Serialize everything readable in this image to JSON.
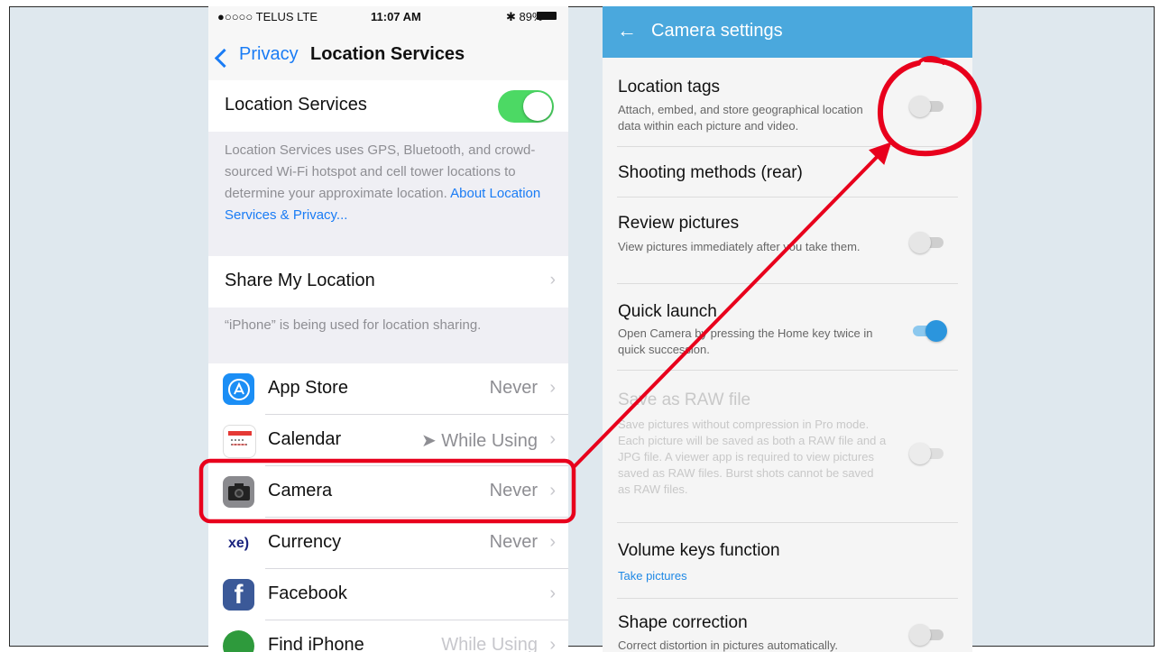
{
  "ios": {
    "status": {
      "carrier": "●○○○○ TELUS  LTE",
      "time": "11:07 AM",
      "battery": "✱ 89%"
    },
    "nav": {
      "back_label": "Privacy",
      "title": "Location Services"
    },
    "location_services": {
      "label": "Location Services",
      "enabled": true,
      "description": "Location Services uses GPS, Bluetooth, and crowd-sourced Wi-Fi hotspot and cell tower locations to determine your approximate location.",
      "link": "About Location Services & Privacy..."
    },
    "share": {
      "label": "Share My Location",
      "footer": "“iPhone” is being used for location sharing."
    },
    "apps": [
      {
        "name": "App Store",
        "value": "Never",
        "icon": "app-store-icon",
        "color": "#1b8ef5"
      },
      {
        "name": "Calendar",
        "value": "➤ While Using",
        "icon": "calendar-icon",
        "color": "#ffffff"
      },
      {
        "name": "Camera",
        "value": "Never",
        "icon": "camera-icon",
        "color": "#8a8a8e"
      },
      {
        "name": "Currency",
        "value": "Never",
        "icon": "currency-icon",
        "color": "#ffffff",
        "glyph": "xe)"
      },
      {
        "name": "Facebook",
        "value": "",
        "icon": "facebook-icon",
        "color": "#3b5998",
        "glyph": "f"
      },
      {
        "name": "Find iPhone",
        "value": "While Using",
        "icon": "find-iphone-icon",
        "color": "#2e9a3c"
      }
    ]
  },
  "android": {
    "header": {
      "title": "Camera settings"
    },
    "items": [
      {
        "title": "Location tags",
        "subtitle": "Attach, embed, and store geographical location data within each picture and video.",
        "switch": "off"
      },
      {
        "title": "Shooting methods (rear)",
        "subtitle": "",
        "switch": "none"
      },
      {
        "title": "Review pictures",
        "subtitle": "View pictures immediately after you take them.",
        "switch": "off"
      },
      {
        "title": "Quick launch",
        "subtitle": "Open Camera by pressing the Home key twice in quick succession.",
        "switch": "on"
      },
      {
        "title": "Save as RAW file",
        "subtitle": "Save pictures without compression in Pro mode. Each picture will be saved as both a RAW file and a JPG file. A viewer app is required to view pictures saved as RAW files. Burst shots cannot be saved as RAW files.",
        "switch": "disabled"
      },
      {
        "title": "Volume keys function",
        "subtitle": "Take pictures",
        "switch": "none"
      },
      {
        "title": "Shape correction",
        "subtitle": "Correct distortion in pictures automatically.",
        "switch": "off"
      }
    ]
  },
  "colors": {
    "annotation": "#e8001c",
    "ios_toggle_on": "#4cd964",
    "ios_link": "#1a7cf5",
    "android_header": "#4aa8dd"
  }
}
